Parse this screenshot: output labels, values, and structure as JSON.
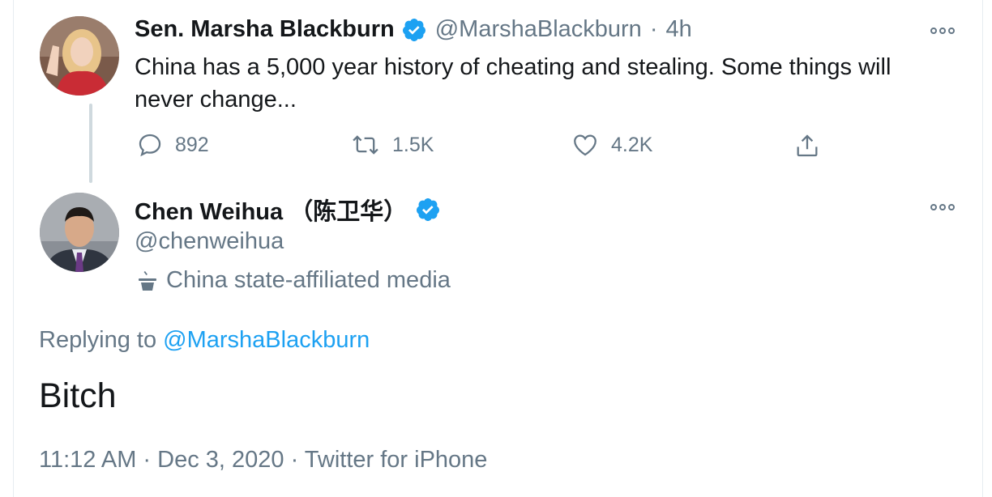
{
  "original_tweet": {
    "display_name": "Sen. Marsha Blackburn",
    "handle": "@MarshaBlackburn",
    "separator": "·",
    "time": "4h",
    "text": "China has a 5,000 year history of cheating and stealing. Some things will never change...",
    "replies": "892",
    "retweets": "1.5K",
    "likes": "4.2K"
  },
  "reply_tweet": {
    "display_name": "Chen Weihua （陈卫华）",
    "handle": "@chenweihua",
    "label": "China state-affiliated media",
    "replying_prefix": "Replying to",
    "replying_handle": "@MarshaBlackburn",
    "text": "Bitch",
    "timestamp": "11:12 AM · Dec 3, 2020 · Twitter for iPhone"
  },
  "colors": {
    "accent": "#1da1f2",
    "muted": "#657786",
    "text": "#14171a"
  }
}
